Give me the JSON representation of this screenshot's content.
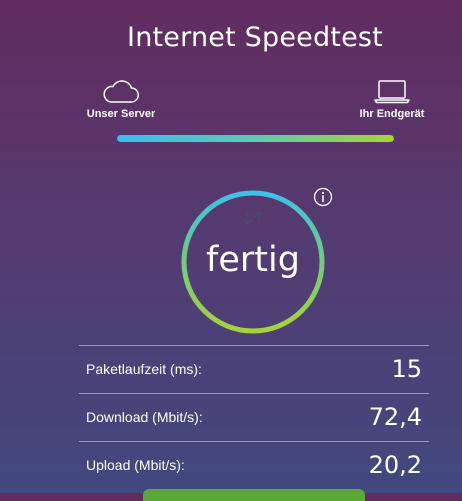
{
  "header": {
    "title": "Internet Speedtest"
  },
  "route": {
    "server_label": "Unser Server",
    "server_icon": "cloud-icon",
    "device_label": "Ihr Endgerät",
    "device_icon": "laptop-icon",
    "progress": 1.0
  },
  "gauge": {
    "status": "fertig",
    "arrows_icon": "down-up-arrows-icon",
    "info_icon": "info-icon",
    "progress": 1.0
  },
  "results": [
    {
      "label": "Paketlaufzeit (ms):",
      "value": "15"
    },
    {
      "label": "Download (Mbit/s):",
      "value": "72,4"
    },
    {
      "label": "Upload (Mbit/s):",
      "value": "20,2"
    }
  ],
  "colors": {
    "background_top": "#622c60",
    "background_bottom": "#41497f",
    "gradient_blue": "#3fb8f0",
    "gradient_green": "#a8d23c",
    "button_green": "#59a838"
  }
}
